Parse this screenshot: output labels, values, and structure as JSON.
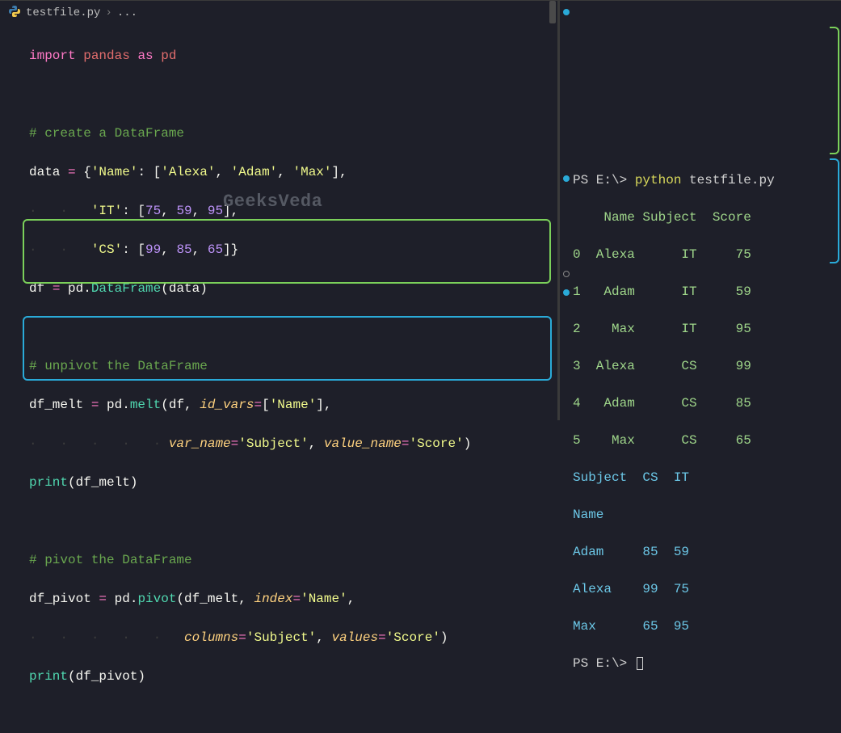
{
  "breadcrumb": {
    "filename": "testfile.py",
    "sep": "›",
    "more": "..."
  },
  "watermark": "GeeksVeda",
  "code": {
    "l1": {
      "kw": "import",
      "mod": "pandas",
      "as": "as",
      "alias": "pd"
    },
    "l3": "# create a DataFrame",
    "l4": {
      "a": "data ",
      "op": "=",
      "b": " {",
      "k1": "'Name'",
      "c1": ": [",
      "v1a": "'Alexa'",
      "s": ", ",
      "v1b": "'Adam'",
      "v1c": "'Max'",
      "c1e": "],"
    },
    "l5": {
      "pad": "        ",
      "k2": "'IT'",
      "c2": ": [",
      "n1": "75",
      "n2": "59",
      "n3": "95",
      "c2e": "],"
    },
    "l6": {
      "pad": "        ",
      "k3": "'CS'",
      "c3": ": [",
      "n1": "99",
      "n2": "85",
      "n3": "65",
      "c3e": "]}"
    },
    "l7": {
      "a": "df ",
      "op": "=",
      "b": " pd.",
      "fn": "DataFrame",
      "c": "(data)"
    },
    "l9": "# unpivot the DataFrame",
    "l10": {
      "a": "df_melt ",
      "op": "=",
      "b": " pd.",
      "fn": "melt",
      "c": "(df, ",
      "arg1": "id_vars",
      "eq": "=",
      "d": "[",
      "s1": "'Name'",
      "e": "],"
    },
    "l11": {
      "pad": "                  ",
      "arg2": "var_name",
      "eq": "=",
      "s2": "'Subject'",
      "sep": ", ",
      "arg3": "value_name",
      "s3": "'Score'",
      "end": ")"
    },
    "l12": {
      "fn": "print",
      "a": "(df_melt)"
    },
    "l14": "# pivot the DataFrame",
    "l15": {
      "a": "df_pivot ",
      "op": "=",
      "b": " pd.",
      "fn": "pivot",
      "c": "(df_melt, ",
      "arg1": "index",
      "eq": "=",
      "s1": "'Name'",
      "end": ","
    },
    "l16": {
      "pad": "                    ",
      "arg2": "columns",
      "eq": "=",
      "s2": "'Subject'",
      "sep": ", ",
      "arg3": "values",
      "s3": "'Score'",
      "end": ")"
    },
    "l17": {
      "fn": "print",
      "a": "(df_pivot)"
    }
  },
  "terminal": {
    "ps": "PS E:\\>",
    "cmd_python": "python",
    "cmd_file": "testfile.py",
    "out1": {
      "hdr": "    Name Subject  Score",
      "r0": "0  Alexa      IT     75",
      "r1": "1   Adam      IT     59",
      "r2": "2    Max      IT     95",
      "r3": "3  Alexa      CS     99",
      "r4": "4   Adam      CS     85",
      "r5": "5    Max      CS     65"
    },
    "out2": {
      "l1": "Subject  CS  IT",
      "l2": "Name",
      "r1": "Adam     85  59",
      "r2": "Alexa    99  75",
      "r3": "Max      65  95"
    }
  }
}
